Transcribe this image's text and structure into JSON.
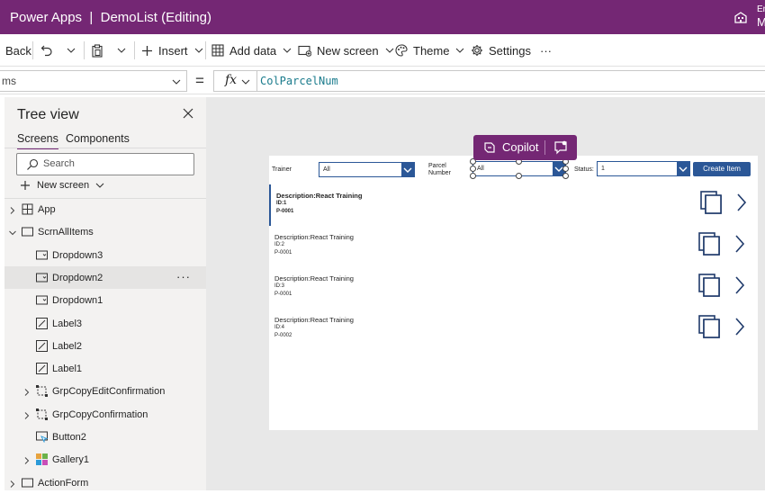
{
  "app": {
    "title": "Power Apps  |  DemoList (Editing)",
    "env_line1": "En",
    "env_line2": "M"
  },
  "toolbar": {
    "back": "Back",
    "insert": "Insert",
    "add_data": "Add data",
    "new_screen": "New screen",
    "theme": "Theme",
    "settings": "Settings",
    "more": "···"
  },
  "formula_bar": {
    "property": "ms",
    "equals": "=",
    "fx": "fx",
    "formula": "ColParcelNum"
  },
  "tree": {
    "title": "Tree view",
    "tabs": [
      "Screens",
      "Components"
    ],
    "search_placeholder": "Search",
    "new_screen": "New screen",
    "items": [
      {
        "label": "App",
        "level": 0,
        "expander": "right",
        "icon": "app"
      },
      {
        "label": "ScrnAllItems",
        "level": 0,
        "expander": "down",
        "icon": "screen"
      },
      {
        "label": "Dropdown3",
        "level": 1,
        "expander": "",
        "icon": "dropdown"
      },
      {
        "label": "Dropdown2",
        "level": 1,
        "expander": "",
        "icon": "dropdown",
        "selected": true
      },
      {
        "label": "Dropdown1",
        "level": 1,
        "expander": "",
        "icon": "dropdown"
      },
      {
        "label": "Label3",
        "level": 1,
        "expander": "",
        "icon": "label"
      },
      {
        "label": "Label2",
        "level": 1,
        "expander": "",
        "icon": "label"
      },
      {
        "label": "Label1",
        "level": 1,
        "expander": "",
        "icon": "label"
      },
      {
        "label": "GrpCopyEditConfirmation",
        "level": 1,
        "expander": "right",
        "icon": "group"
      },
      {
        "label": "GrpCopyConfirmation",
        "level": 1,
        "expander": "right",
        "icon": "group"
      },
      {
        "label": "Button2",
        "level": 1,
        "expander": "",
        "icon": "button"
      },
      {
        "label": "Gallery1",
        "level": 1,
        "expander": "right",
        "icon": "gallery"
      },
      {
        "label": "ActionForm",
        "level": 0,
        "expander": "right",
        "icon": "screen"
      }
    ],
    "more": "···"
  },
  "copilot": {
    "label": "Copilot"
  },
  "app_screen": {
    "trainer_label": "Trainer",
    "trainer_value": "All",
    "parcel_label": "Parcel\nNumber",
    "parcel_value": "All",
    "status_label": "Status:",
    "status_value": "1",
    "create_button": "Create Item",
    "gallery": [
      {
        "description": "Description:React Training",
        "id": "ID:1",
        "parcel": "P-0001"
      },
      {
        "description": "Description:React Training",
        "id": "ID:2",
        "parcel": "P-0001"
      },
      {
        "description": "Description:React Training",
        "id": "ID:3",
        "parcel": "P-0001"
      },
      {
        "description": "Description:React Training",
        "id": "ID:4",
        "parcel": "P-0002"
      }
    ]
  },
  "colors": {
    "brand": "#742774",
    "control_blue": "#2b5797",
    "formula_text": "#1a7b8c"
  }
}
